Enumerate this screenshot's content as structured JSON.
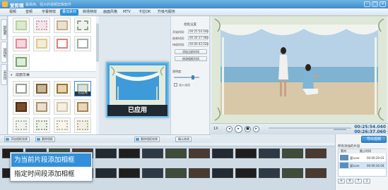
{
  "app": {
    "title": "爱剪辑",
    "subtitle": "最易用、强大的视频剪辑软件",
    "window_buttons": [
      "–",
      "□",
      "×"
    ]
  },
  "menu": {
    "items": [
      {
        "label": "视频"
      },
      {
        "label": "音频"
      },
      {
        "label": "字幕特效"
      },
      {
        "label": "叠加素材"
      },
      {
        "label": "转场特效"
      },
      {
        "label": "画面风格"
      },
      {
        "label": "MTV"
      },
      {
        "label": "卡拉OK"
      },
      {
        "label": "升级与服务"
      }
    ],
    "active_index": 3
  },
  "vtabs": [
    {
      "label": "加贴图"
    },
    {
      "label": "加相框"
    },
    {
      "label": "去水印"
    }
  ],
  "library": {
    "category_label": "炫丽华美",
    "applied_label": "已应用"
  },
  "zoom_preview": {
    "banner": "已应用"
  },
  "settings": {
    "title": "相框设置",
    "rows": [
      {
        "label": "开始时间:",
        "value": "00:25:54.040"
      },
      {
        "label": "结束时间:",
        "value": "00:26:37.060"
      },
      {
        "label": "持续时间:",
        "value": "00:00:43.020"
      }
    ],
    "btn_cur": "添加当前时间",
    "btn_time": "修改相框时间",
    "opacity_label": "透明度:",
    "opacity_value": 0.75,
    "checkbox_label": "淡入淡出"
  },
  "video": {
    "speed_label": "1X",
    "current_time": "00:25:54.040",
    "total_time": "00:26:37.060"
  },
  "lib_toolbar": {
    "btn_add": "添加相框效果",
    "btn_del": "删除相框",
    "btn_modify": "删除相框效果",
    "btn_undo": "确认修改"
  },
  "timeline": {
    "clips_top": [
      "《雪之》",
      "爱Love《TO",
      "《TH》",
      "未命名",
      "《Ame》",
      "爱Love《TE",
      "《雪之》",
      "爱Love《",
      "未命名",
      "爱Love《TOP",
      "《雪之》",
      "爱Love《TC",
      "《雪之》",
      "爱Love《TOP"
    ],
    "clips_bottom": [
      "爱Love《",
      "《TH》",
      "未命名",
      "爱Love《",
      "《雪之》",
      "爱Love《",
      "未命名",
      "爱Love《",
      "未命名",
      "爱Love《TOP",
      "《雪之》",
      "爱Love《",
      "《雪之》",
      "爱Love《TOP"
    ]
  },
  "popup": {
    "items": [
      {
        "label": "为当前片段添加相框"
      },
      {
        "label": "指定时间段添加相框"
      }
    ],
    "highlight_index": 0
  },
  "seg_panel": {
    "export_label": "导出视频",
    "title": "所有添加的片段",
    "head_col1": "素材",
    "head_col2": "截止时间",
    "rows": [
      {
        "name": "爱Love",
        "time": "00:00:29.03"
      },
      {
        "name": "爱Love",
        "time": "00:00:34.04"
      }
    ],
    "btns": [
      "+",
      "×",
      "↑",
      "↓"
    ]
  }
}
